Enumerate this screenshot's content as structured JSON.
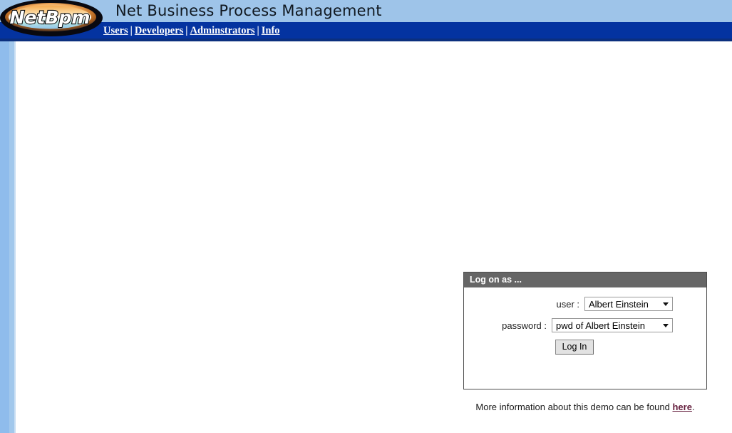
{
  "header": {
    "title": "Net Business Process Management",
    "logo_text": "NetBpm",
    "nav": [
      {
        "label": "Users",
        "name": "nav-users"
      },
      {
        "label": "Developers",
        "name": "nav-developers"
      },
      {
        "label": "Adminstrators",
        "name": "nav-administrators"
      },
      {
        "label": "Info",
        "name": "nav-info"
      }
    ],
    "separator": "|",
    "colors": {
      "top_band": "#9ec4e9",
      "nav_band": "#0433a0",
      "nav_underline": "#0b2f7e",
      "nav_link": "#ffffff"
    }
  },
  "sidebar": {
    "rail_color": "#8fbcec",
    "rail_inner_color": "#a2c8ec"
  },
  "login": {
    "panel_title": "Log on as ...",
    "panel_title_bg": "#666666",
    "user": {
      "label": "user :",
      "value": "Albert Einstein",
      "options": [
        "Albert Einstein"
      ]
    },
    "password": {
      "label": "password :",
      "value": "pwd of Albert Einstein",
      "options": [
        "pwd of Albert Einstein"
      ]
    },
    "submit_label": "Log In"
  },
  "footer_note": {
    "text_before": "More information about this demo can be found ",
    "link_label": "here",
    "text_after": ".",
    "link_color": "#66203f"
  }
}
